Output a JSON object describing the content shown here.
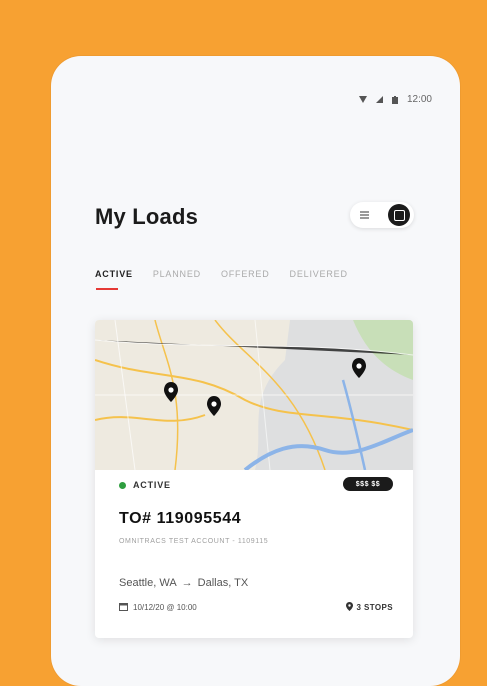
{
  "status_bar": {
    "time": "12:00",
    "icons": [
      "wifi-icon",
      "signal-icon",
      "battery-icon"
    ]
  },
  "page": {
    "title": "My Loads"
  },
  "tabs": [
    {
      "label": "ACTIVE",
      "selected": true
    },
    {
      "label": "PLANNED",
      "selected": false
    },
    {
      "label": "OFFERED",
      "selected": false
    },
    {
      "label": "DELIVERED",
      "selected": false
    }
  ],
  "load_card": {
    "status": "ACTIVE",
    "status_color": "#2E9E3F",
    "badge": "$$$ $$",
    "load_number": "TO# 119095544",
    "account": "OMNITRACS TEST ACCOUNT - 1109115",
    "origin": "Seattle, WA",
    "route_arrow": "→",
    "destination": "Dallas, TX",
    "date": "10/12/20 @ 10:00",
    "stops": "3 STOPS"
  },
  "colors": {
    "background": "#F7A132",
    "accent": "#E53935"
  }
}
